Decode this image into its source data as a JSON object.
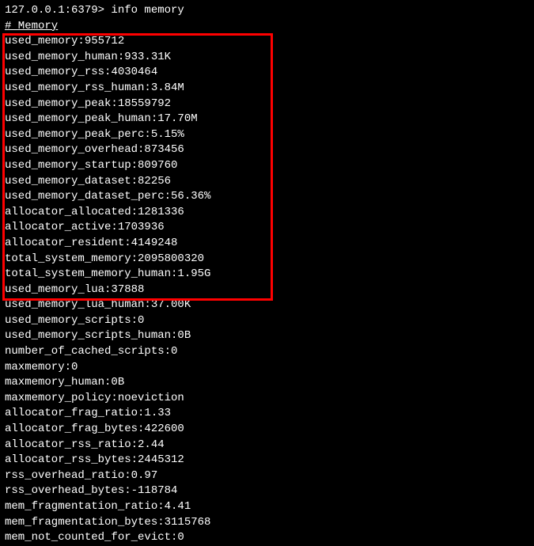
{
  "prompt": "127.0.0.1:6379> ",
  "command": "info memory",
  "section_header": "# Memory",
  "lines_highlighted": [
    "used_memory:955712",
    "used_memory_human:933.31K",
    "used_memory_rss:4030464",
    "used_memory_rss_human:3.84M",
    "used_memory_peak:18559792",
    "used_memory_peak_human:17.70M",
    "used_memory_peak_perc:5.15%",
    "used_memory_overhead:873456",
    "used_memory_startup:809760",
    "used_memory_dataset:82256",
    "used_memory_dataset_perc:56.36%",
    "allocator_allocated:1281336",
    "allocator_active:1703936",
    "allocator_resident:4149248",
    "total_system_memory:2095800320",
    "total_system_memory_human:1.95G",
    "used_memory_lua:37888"
  ],
  "lines_rest": [
    "used_memory_lua_human:37.00K",
    "used_memory_scripts:0",
    "used_memory_scripts_human:0B",
    "number_of_cached_scripts:0",
    "maxmemory:0",
    "maxmemory_human:0B",
    "maxmemory_policy:noeviction",
    "allocator_frag_ratio:1.33",
    "allocator_frag_bytes:422600",
    "allocator_rss_ratio:2.44",
    "allocator_rss_bytes:2445312",
    "rss_overhead_ratio:0.97",
    "rss_overhead_bytes:-118784",
    "mem_fragmentation_ratio:4.41",
    "mem_fragmentation_bytes:3115768",
    "mem_not_counted_for_evict:0"
  ]
}
